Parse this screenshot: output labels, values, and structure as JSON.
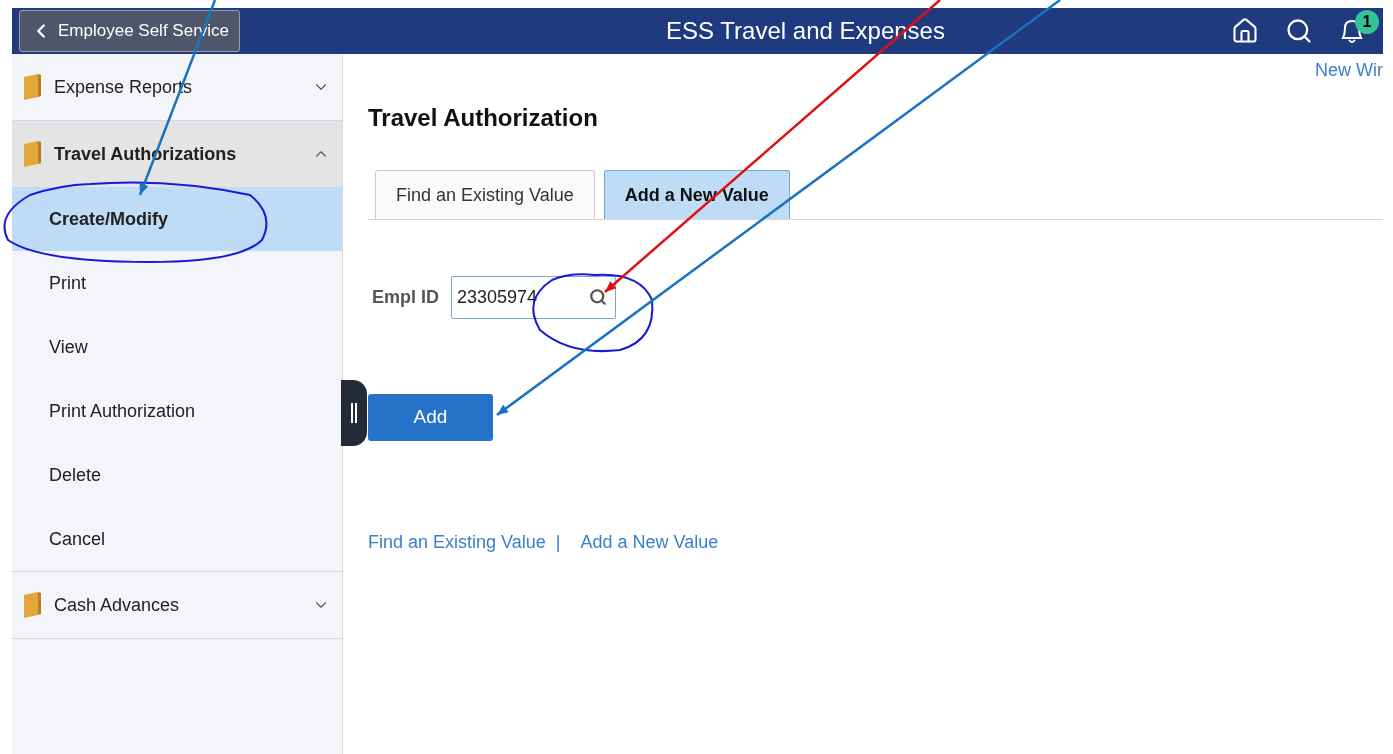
{
  "header": {
    "back_button": "Employee Self Service",
    "title": "ESS Travel and Expenses",
    "notification_count": "1"
  },
  "sidebar": {
    "groups": [
      {
        "label": "Expense Reports",
        "expanded": false
      },
      {
        "label": "Travel Authorizations",
        "expanded": true,
        "items": [
          {
            "label": "Create/Modify",
            "selected": true
          },
          {
            "label": "Print",
            "selected": false
          },
          {
            "label": "View",
            "selected": false
          },
          {
            "label": "Print Authorization",
            "selected": false
          },
          {
            "label": "Delete",
            "selected": false
          },
          {
            "label": "Cancel",
            "selected": false
          }
        ]
      },
      {
        "label": "Cash Advances",
        "expanded": false
      }
    ]
  },
  "content": {
    "new_window_link": "New Wir",
    "title": "Travel Authorization",
    "tabs": [
      {
        "label": "Find an Existing Value",
        "selected": false
      },
      {
        "label": "Add a New Value",
        "selected": true
      }
    ],
    "field": {
      "label": "Empl ID",
      "value": "23305974"
    },
    "add_button": "Add",
    "footer_links": [
      {
        "label": "Find an Existing Value"
      },
      {
        "label": "Add a New Value"
      }
    ],
    "separator": "|"
  }
}
